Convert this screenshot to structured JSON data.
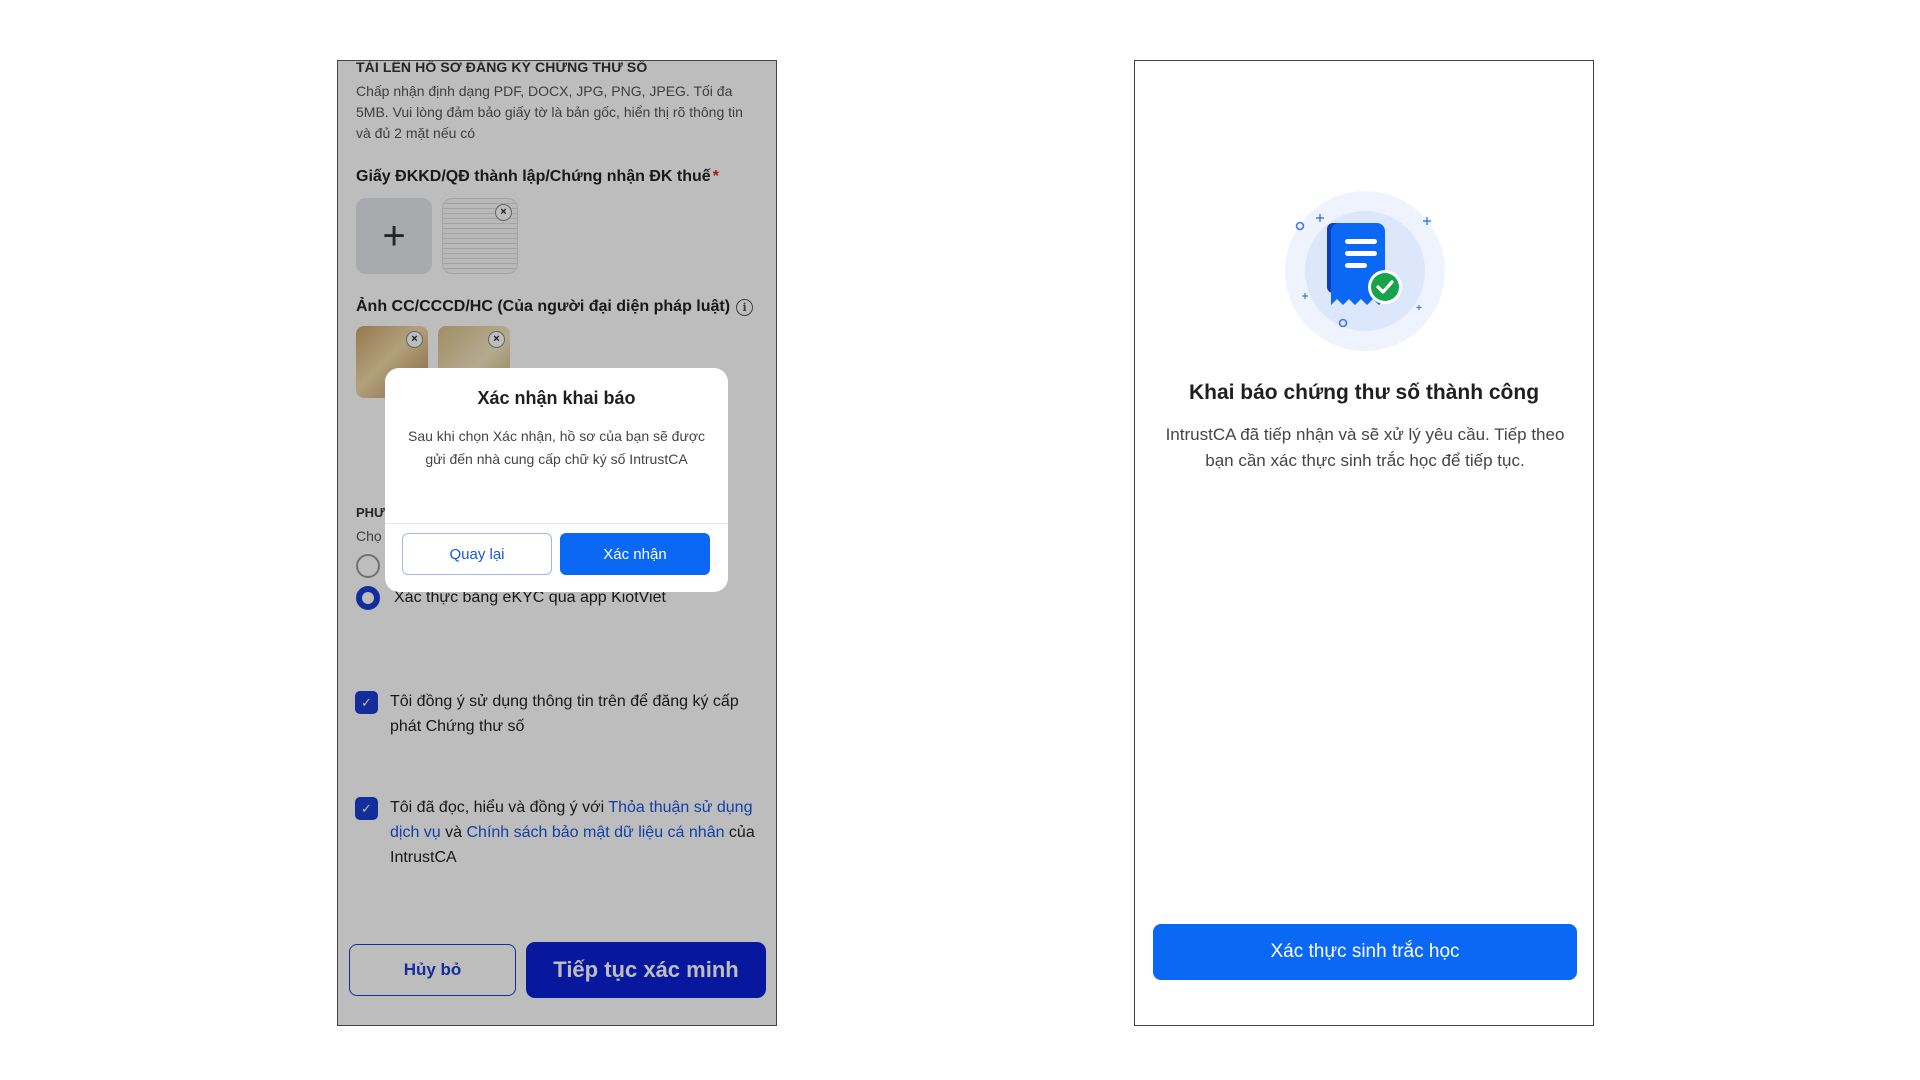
{
  "left_screen": {
    "upload": {
      "title": "TẢI LÊN HỒ SƠ ĐĂNG KÝ CHỨNG THƯ SỐ",
      "description": "Chấp nhận định dạng PDF, DOCX, JPG, PNG, JPEG. Tối đa 5MB. Vui lòng đảm bảo giấy tờ là bản gốc, hiển thị rõ thông tin và đủ 2 mặt nếu có",
      "business_doc_label": "Giấy ĐKKD/QĐ thành lập/Chứng nhận ĐK thuế",
      "required_mark": "*",
      "id_photo_label": "Ảnh CC/CCCD/HC (Của người đại diện pháp luật)",
      "add_symbol": "+",
      "remove_symbol": "×",
      "info_symbol": "i"
    },
    "verification": {
      "title_partial": "PHƯ",
      "subtitle_partial": "Chọ",
      "option_ekyc": "Xác thực bằng eKYC qua app KiotViet"
    },
    "agreements": {
      "agree_1": "Tôi đồng ý sử dụng thông tin trên để đăng ký cấp phát Chứng thư số",
      "agree_2_prefix": "Tôi đã đọc, hiểu và đồng ý với ",
      "agree_2_link_1": "Thỏa thuận sử dụng dịch vụ",
      "agree_2_middle": " và ",
      "agree_2_link_2": "Chính sách bảo mật dữ liệu cá nhân",
      "agree_2_suffix": " của IntrustCA",
      "check_symbol": "✓"
    },
    "bottom": {
      "cancel_label": "Hủy bỏ",
      "continue_label": "Tiếp tục xác minh"
    },
    "modal": {
      "title": "Xác nhận khai báo",
      "body": "Sau khi chọn Xác nhận, hồ sơ của bạn sẽ được gửi đến nhà cung cấp chữ ký số IntrustCA",
      "back_label": "Quay lại",
      "confirm_label": "Xác nhận"
    }
  },
  "right_screen": {
    "success_title": "Khai báo chứng thư số thành công",
    "success_description": "IntrustCA đã tiếp nhận và sẽ xử lý yêu cầu. Tiếp theo bạn cần xác thực sinh trắc học để tiếp tục.",
    "biometric_button_label": "Xác thực sinh trắc học",
    "illustration_icon": "document-check-icon"
  },
  "colors": {
    "primary_blue": "#0a68f5",
    "dark_blue": "#0a1fd6",
    "success_green": "#16a34a",
    "link_blue": "#1a56e0"
  }
}
